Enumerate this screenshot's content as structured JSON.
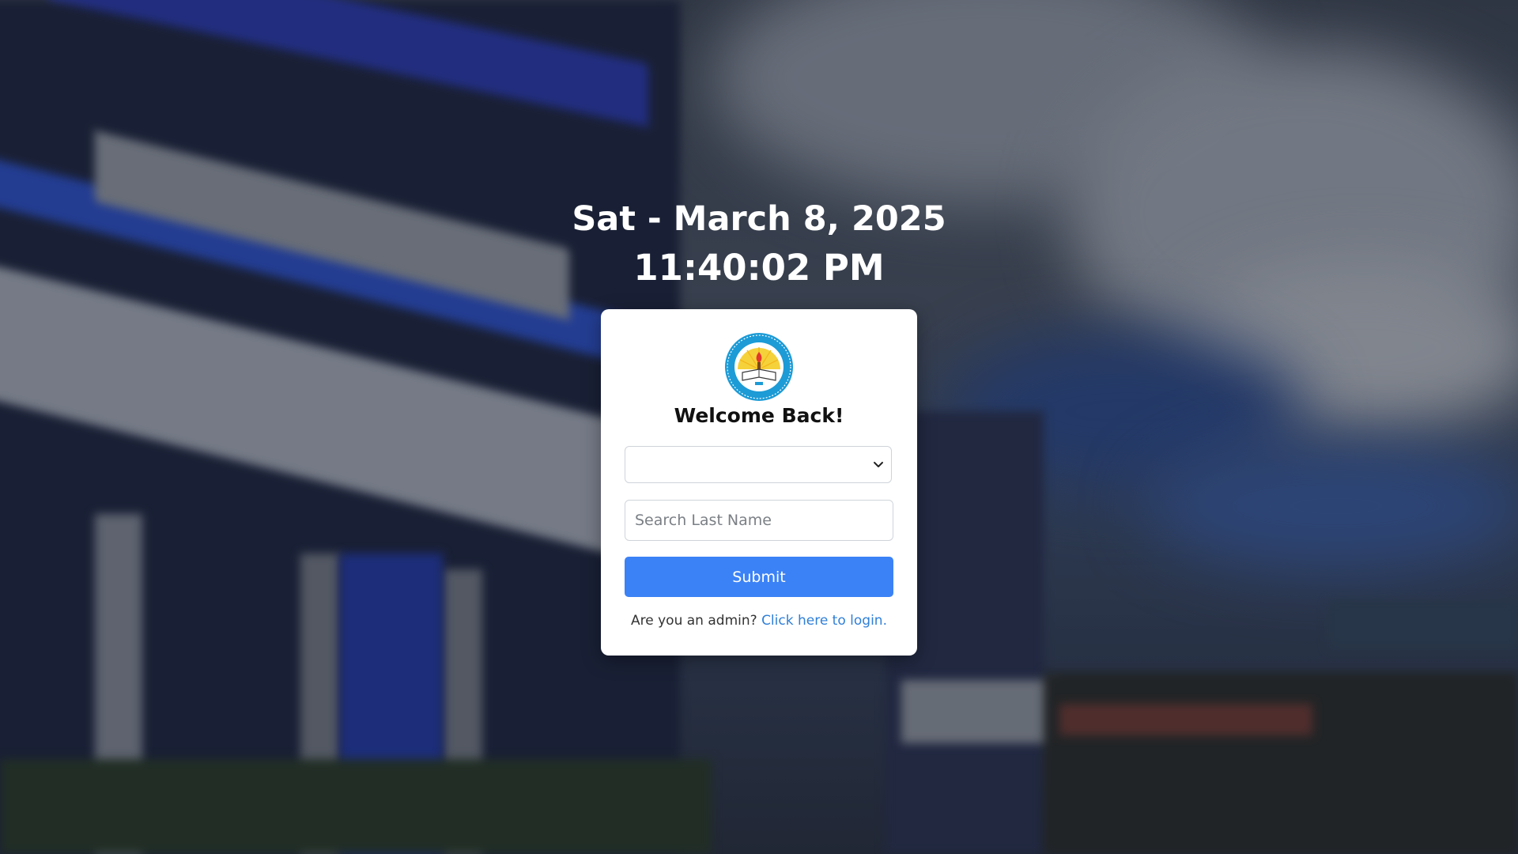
{
  "clock": {
    "date": "Sat - March 8, 2025",
    "time": "11:40:02 PM"
  },
  "card": {
    "welcome": "Welcome Back!",
    "select_value": "",
    "search_placeholder": "Search Last Name",
    "submit_label": "Submit",
    "admin_prompt": "Are you an admin?",
    "admin_link": "Click here to login.",
    "logo_icon": "school-seal-icon"
  },
  "colors": {
    "primary": "#3b82f6",
    "link": "#2f7fd8",
    "card_bg": "#ffffff"
  }
}
